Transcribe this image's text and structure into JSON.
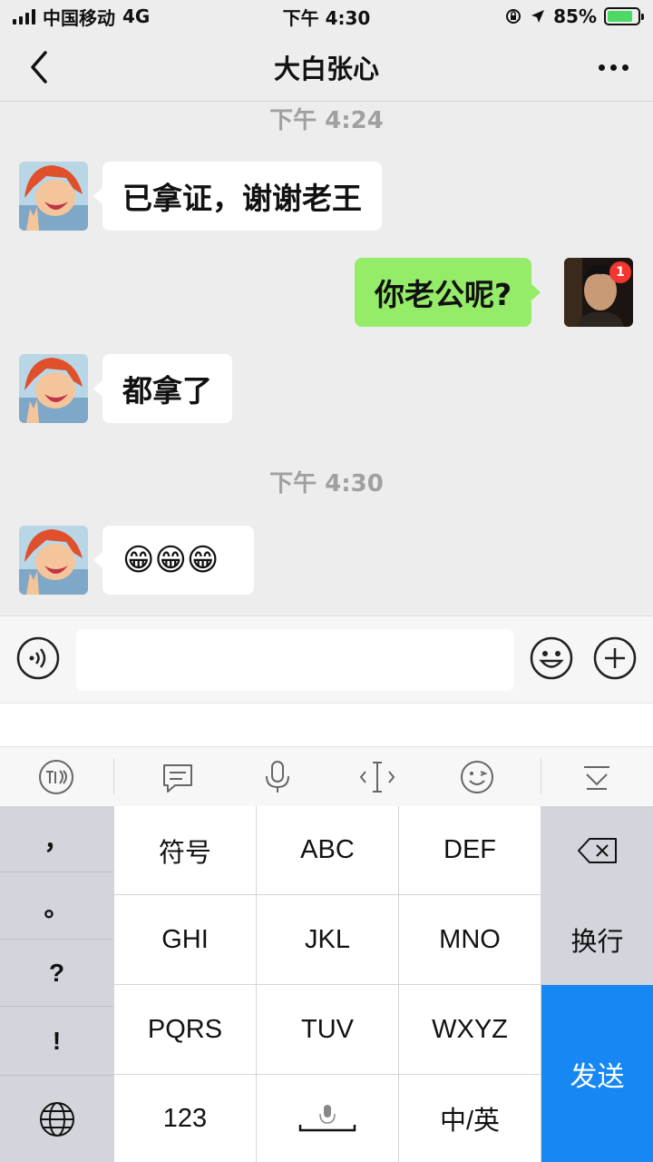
{
  "status_bar": {
    "carrier": "中国移动",
    "network": "4G",
    "time": "下午 4:30",
    "battery": "85%"
  },
  "nav": {
    "title": "大白张心",
    "back_icon": "chevron-left-icon",
    "more_icon": "more-dots-icon"
  },
  "messages": [
    {
      "type": "timestamp",
      "text": "下午 4:24"
    },
    {
      "type": "message",
      "side": "left",
      "text": "已拿证，谢谢老王"
    },
    {
      "type": "message",
      "side": "right",
      "text": "你老公呢?",
      "badge": "1"
    },
    {
      "type": "message",
      "side": "left",
      "text": "都拿了"
    },
    {
      "type": "timestamp",
      "text": "下午 4:30"
    },
    {
      "type": "message",
      "side": "left",
      "text": "😁😁😁"
    }
  ],
  "input_bar": {
    "value": "",
    "voice_icon": "voice-icon",
    "emoji_icon": "emoji-icon",
    "plus_icon": "plus-circle-icon"
  },
  "keyboard_toolbar": [
    "xunfei-logo-icon",
    "message-icon",
    "microphone-icon",
    "cursor-icon",
    "wink-emoji-icon",
    "collapse-keyboard-icon"
  ],
  "keyboard": {
    "left_column": [
      "，",
      "。",
      "?",
      "!"
    ],
    "globe_icon": "globe-icon",
    "rows": [
      [
        "符号",
        "ABC",
        "DEF"
      ],
      [
        "GHI",
        "JKL",
        "MNO"
      ],
      [
        "PQRS",
        "TUV",
        "WXYZ"
      ],
      [
        "123",
        "",
        "中/英"
      ]
    ],
    "backspace_icon": "backspace-icon",
    "newline": "换行",
    "send": "发送"
  },
  "colors": {
    "chat_bg": "#ededed",
    "outgoing_bubble": "#95ec69",
    "incoming_bubble": "#ffffff",
    "send_key": "#1787f4",
    "badge": "#f43530"
  }
}
